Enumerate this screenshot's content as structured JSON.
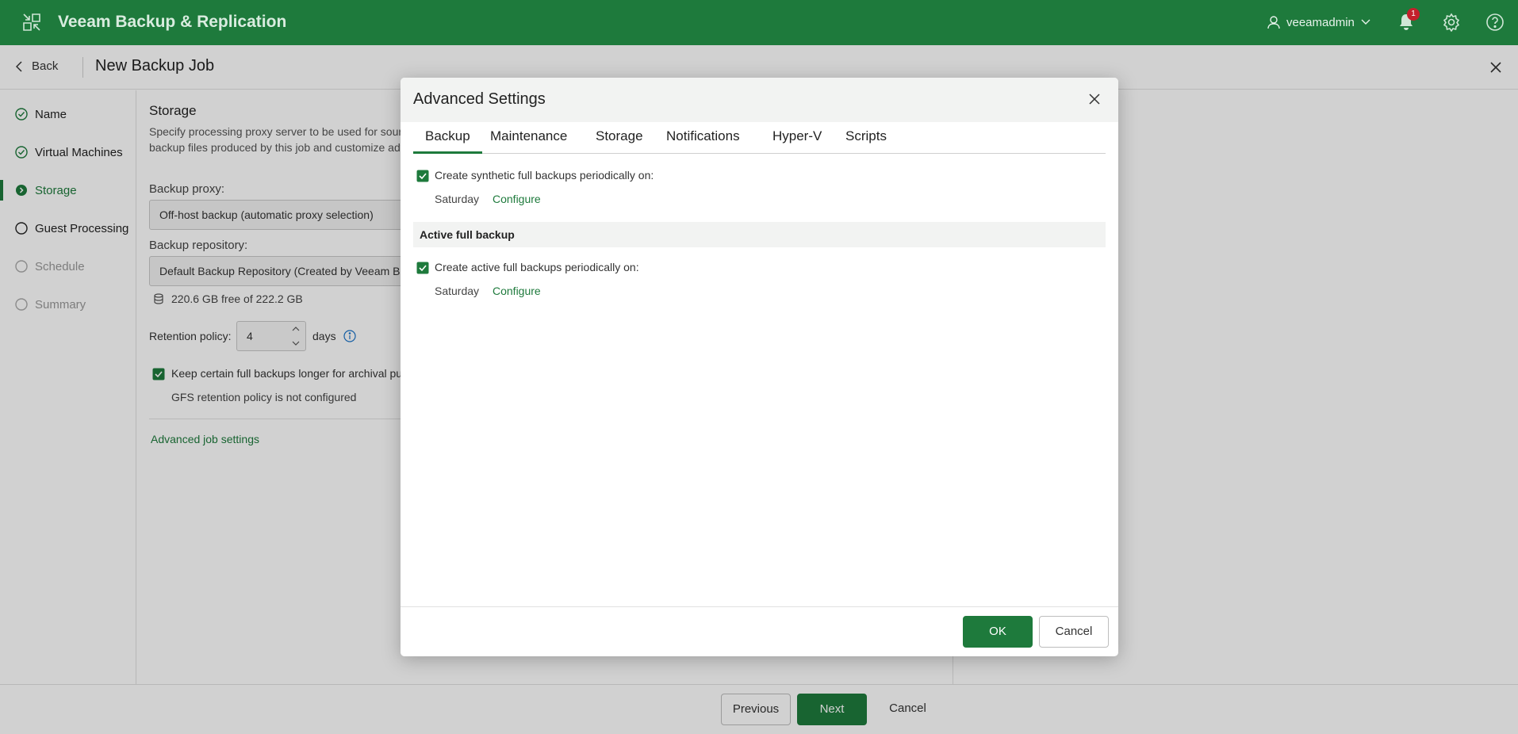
{
  "app": {
    "title": "Veeam Backup & Replication",
    "user": "veeamadmin",
    "notifications_count": "1",
    "icons": [
      "app-grid-icon",
      "user-icon",
      "chevron-down-icon",
      "bell-icon",
      "gear-icon",
      "help-icon"
    ]
  },
  "wizard": {
    "back_label": "Back",
    "title": "New Backup Job",
    "steps": [
      {
        "label": "Name",
        "state": "done"
      },
      {
        "label": "Virtual Machines",
        "state": "done"
      },
      {
        "label": "Storage",
        "state": "current"
      },
      {
        "label": "Guest Processing",
        "state": "pending"
      },
      {
        "label": "Schedule",
        "state": "disabled"
      },
      {
        "label": "Summary",
        "state": "disabled"
      }
    ],
    "footer": {
      "previous": "Previous",
      "next": "Next",
      "cancel": "Cancel"
    }
  },
  "storage": {
    "title": "Storage",
    "desc_line1": "Specify processing proxy server to be used for sour",
    "desc_line2": "backup files produced by this job and customize adv",
    "proxy_label": "Backup proxy:",
    "proxy_value": "Off-host backup (automatic proxy selection)",
    "repo_label": "Backup repository:",
    "repo_value": "Default Backup Repository (Created by Veeam Ba",
    "free_space": "220.6 GB free of 222.2 GB",
    "retention_label": "Retention policy:",
    "retention_value": "4",
    "retention_unit": "days",
    "gfs_label": "Keep certain full backups longer for archival pur",
    "gfs_checked": true,
    "gfs_note": "GFS retention policy is not configured",
    "advanced_link": "Advanced job settings"
  },
  "dialog": {
    "title": "Advanced Settings",
    "tabs": [
      "Backup",
      "Maintenance",
      "Storage",
      "Notifications",
      "Hyper-V",
      "Scripts"
    ],
    "active_tab": "Backup",
    "synthetic": {
      "label": "Create synthetic full backups periodically on:",
      "checked": true,
      "day": "Saturday",
      "configure": "Configure"
    },
    "active_group": "Active full backup",
    "active": {
      "label": "Create active full backups periodically on:",
      "checked": true,
      "day": "Saturday",
      "configure": "Configure"
    },
    "ok": "OK",
    "cancel": "Cancel"
  },
  "colors": {
    "brand": "#1e7a3c",
    "badge": "#c4202c"
  }
}
